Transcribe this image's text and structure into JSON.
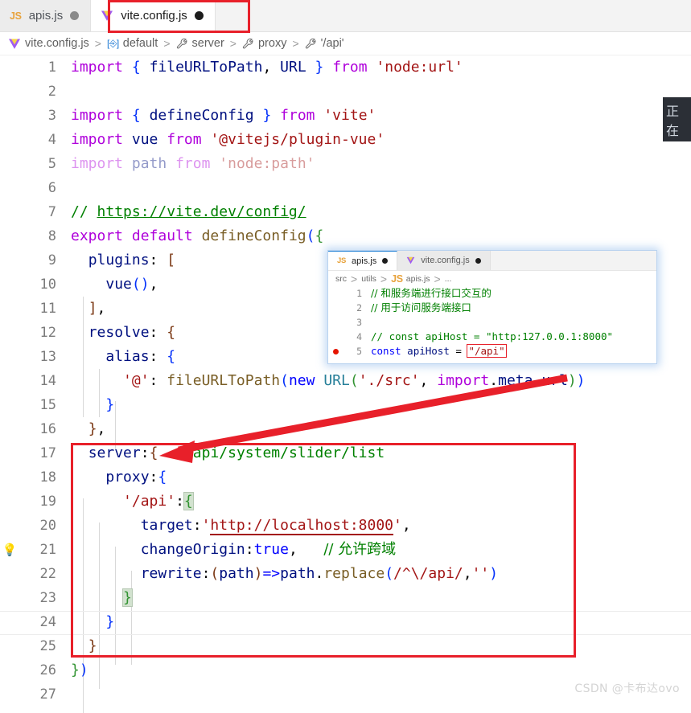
{
  "tabs": [
    {
      "label": "apis.js",
      "icon": "js-file-icon",
      "dirty": true,
      "active": false
    },
    {
      "label": "vite.config.js",
      "icon": "vite-file-icon",
      "dirty": true,
      "active": true
    }
  ],
  "breadcrumb": {
    "items": [
      {
        "label": "vite.config.js",
        "icon": "vite-file-icon"
      },
      {
        "label": "default",
        "icon": "symbol-object-icon"
      },
      {
        "label": "server",
        "icon": "wrench-icon"
      },
      {
        "label": "proxy",
        "icon": "wrench-icon"
      },
      {
        "label": "'/api'",
        "icon": "wrench-icon"
      }
    ],
    "separator": ">"
  },
  "editor": {
    "lines": [
      {
        "n": "1",
        "text": "import { fileURLToPath, URL } from 'node:url'"
      },
      {
        "n": "2",
        "text": ""
      },
      {
        "n": "3",
        "text": "import { defineConfig } from 'vite'"
      },
      {
        "n": "4",
        "text": "import vue from '@vitejs/plugin-vue'"
      },
      {
        "n": "5",
        "text": "import path from 'node:path'"
      },
      {
        "n": "6",
        "text": ""
      },
      {
        "n": "7",
        "text": "// https://vite.dev/config/"
      },
      {
        "n": "8",
        "text": "export default defineConfig({"
      },
      {
        "n": "9",
        "text": "  plugins: ["
      },
      {
        "n": "10",
        "text": "    vue(),"
      },
      {
        "n": "11",
        "text": "  ],"
      },
      {
        "n": "12",
        "text": "  resolve: {"
      },
      {
        "n": "13",
        "text": "    alias: {"
      },
      {
        "n": "14",
        "text": "      '@': fileURLToPath(new URL('./src', import.meta.url))"
      },
      {
        "n": "15",
        "text": "    }"
      },
      {
        "n": "16",
        "text": "  },"
      },
      {
        "n": "17",
        "text": "  server:{  //api/system/slider/list"
      },
      {
        "n": "18",
        "text": "    proxy:{"
      },
      {
        "n": "19",
        "text": "      '/api':{"
      },
      {
        "n": "20",
        "text": "        target:'http://localhost:8000',"
      },
      {
        "n": "21",
        "text": "        changeOrigin:true,   // 允许跨域"
      },
      {
        "n": "22",
        "text": "        rewrite:(path)=>path.replace(/^\\/api/,'')"
      },
      {
        "n": "23",
        "text": "      }"
      },
      {
        "n": "24",
        "text": "    }"
      },
      {
        "n": "25",
        "text": "  }"
      },
      {
        "n": "26",
        "text": "})"
      },
      {
        "n": "27",
        "text": ""
      }
    ],
    "gutter_lightbulb_line": "21",
    "comment_line7_url": "https://vite.dev/config/",
    "comment_line17": "//api/system/slider/list",
    "comment_line21": "// 允许跨域",
    "target_url": "http://localhost:8000"
  },
  "popup": {
    "tabs": [
      {
        "label": "apis.js",
        "icon": "js-file-icon",
        "dirty": true,
        "active": false
      },
      {
        "label": "vite.config.js",
        "icon": "vite-file-icon",
        "dirty": true,
        "active": true
      }
    ],
    "breadcrumb": {
      "items": [
        "src",
        "utils",
        "apis.js",
        "..."
      ],
      "separator": ">",
      "file_icon": "js-file-icon"
    },
    "lines": [
      {
        "n": "1",
        "text": "// 和服务端进行接口交互的",
        "breakpoint": false
      },
      {
        "n": "2",
        "text": "// 用于访问服务端接口",
        "breakpoint": false
      },
      {
        "n": "3",
        "text": "",
        "breakpoint": false
      },
      {
        "n": "4",
        "text": "// const apiHost = \"http:127.0.0.1:8000\"",
        "breakpoint": false
      },
      {
        "n": "5",
        "text": "const apiHost = \"/api\"",
        "breakpoint": true
      }
    ],
    "highlighted_value": "\"/api\""
  },
  "edge_tooltip": {
    "text": "正在"
  },
  "watermark": {
    "text": "CSDN @卡布达ovo"
  },
  "colors": {
    "annotation_red": "#e8202a",
    "keyword_purple": "#af00db",
    "string_red": "#a31515",
    "comment_green": "#008000",
    "identifier_navy": "#001080",
    "function_gold": "#795e26",
    "breakpoint_red": "#e51400"
  }
}
